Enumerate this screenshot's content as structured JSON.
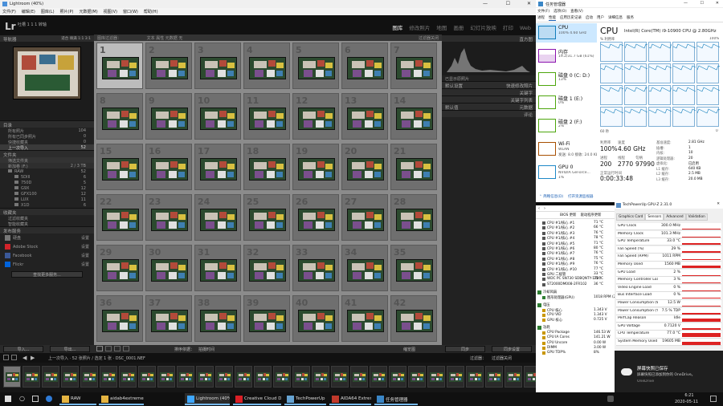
{
  "lightroom": {
    "window_title": "Lightroom (40%)",
    "menu": [
      "文件(F)",
      "编辑(E)",
      "图库(L)",
      "照片(P)",
      "元数据(M)",
      "视图(V)",
      "窗口(W)",
      "帮助(H)"
    ],
    "identity": "吐槽 1 1 1 转轴",
    "logo": "Lr",
    "modules": [
      "图库",
      "修改照片",
      "地图",
      "画册",
      "幻灯片放映",
      "打印",
      "Web"
    ],
    "active_module": "图库",
    "navigator_label": "导航器",
    "navigator_zoom": "适合 填满 1:1 3:1",
    "catalog": {
      "header": "目录",
      "items": [
        {
          "label": "所有照片",
          "count": "104"
        },
        {
          "label": "所有已同步照片",
          "count": "0"
        },
        {
          "label": "快捷收藏夹",
          "count": "0"
        },
        {
          "label": "上一次导入",
          "count": "52"
        }
      ]
    },
    "folders": {
      "header": "文件夹",
      "filter": "筛选文件夹",
      "volume": "新加卷 (F:)",
      "volume_info": "2 / 3 TB",
      "items": [
        {
          "label": "RAW",
          "count": "52"
        },
        {
          "label": "5DIII",
          "count": "6"
        },
        {
          "label": "750D",
          "count": "5"
        },
        {
          "label": "G9X",
          "count": "12"
        },
        {
          "label": "GFX100",
          "count": "12"
        },
        {
          "label": "LUX",
          "count": "11"
        },
        {
          "label": "X1D",
          "count": "6"
        }
      ]
    },
    "collections": {
      "header": "收藏夹",
      "items": [
        "过滤收藏夹",
        "智能收藏夹"
      ]
    },
    "publish": {
      "header": "发布服务",
      "items": [
        {
          "label": "硬盘",
          "badge": "设置"
        },
        {
          "label": "Adobe Stock",
          "badge": "设置"
        },
        {
          "label": "Facebook",
          "badge": "设置"
        },
        {
          "label": "Flickr",
          "badge": "设置"
        }
      ],
      "more": "查找更多服务..."
    },
    "grid_filter": "图库过滤器：",
    "filter_tabs": "文本 属性 元数据 无",
    "filter_preset": "过滤器关闭",
    "right_panel": {
      "histogram": "直方图",
      "histogram_info": "已显示原照片",
      "quick_develop": "快速修改照片",
      "preset_value": "默认设置",
      "keywording": "关键字",
      "keyword_list": "关键字列表",
      "metadata": "元数据",
      "metadata_value": "默认值",
      "comments": "评论"
    },
    "buttons": {
      "import": "导入...",
      "export": "导出...",
      "sync": "同步",
      "sync_settings": "同步设置"
    },
    "toolbar": {
      "sort_label": "排序依据：",
      "sort_value": "拍摄时间",
      "thumbnails": "缩览图"
    },
    "filmstrip_info": "上一次导入 · 52 张照片 / 选定 1 张 · DSC_0001.NEF",
    "filmstrip_filter": "过滤器：",
    "filmstrip_filter_value": "过滤器关闭",
    "grid_count": 42
  },
  "task_manager": {
    "title": "任务管理器",
    "menu": [
      "文件(F)",
      "选项(O)",
      "查看(V)"
    ],
    "tabs": [
      "进程",
      "性能",
      "应用历史记录",
      "启动",
      "用户",
      "详细信息",
      "服务"
    ],
    "active_tab": "性能",
    "sidebar": [
      {
        "name": "CPU",
        "sub": "100% 4.60 GHz"
      },
      {
        "name": "内存",
        "sub": "19.2/31.7 GB (61%)"
      },
      {
        "name": "磁盘 0 (C: D:)",
        "sub": "13%"
      },
      {
        "name": "磁盘 1 (E:)",
        "sub": "0%"
      },
      {
        "name": "磁盘 2 (F:)",
        "sub": "2%"
      },
      {
        "name": "Wi-Fi",
        "sub": "WLAN"
      },
      {
        "name": "GPU 0",
        "sub": "NVIDIA GeForce..."
      }
    ],
    "wifi_rate": "发送: 8.0 接收: 24.0 Kb",
    "gpu_sub": "1%",
    "cpu_title": "CPU",
    "cpu_model": "Intel(R) Core(TM) i9-10900 CPU @ 2.80GHz",
    "util_label": "% 利用率",
    "util_max": "100%",
    "time_label": "60 秒",
    "time_min": "0",
    "stats": {
      "utilization_label": "利用率",
      "utilization": "100%",
      "speed_label": "速度",
      "speed": "4.60 GHz",
      "processes_label": "进程",
      "processes": "200",
      "threads_label": "线程",
      "threads": "2770",
      "handles_label": "句柄",
      "handles": "97990",
      "uptime_label": "正常运行时间",
      "uptime": "0:00:33:48"
    },
    "specs": [
      {
        "k": "基准速度:",
        "v": "2.81 GHz"
      },
      {
        "k": "插槽:",
        "v": "1"
      },
      {
        "k": "内核:",
        "v": "10"
      },
      {
        "k": "逻辑处理器:",
        "v": "20"
      },
      {
        "k": "虚拟化:",
        "v": "已启用"
      },
      {
        "k": "L1 缓存:",
        "v": "640 KB"
      },
      {
        "k": "L2 缓存:",
        "v": "2.5 MB"
      },
      {
        "k": "L3 缓存:",
        "v": "20.0 MB"
      }
    ],
    "summary_link": "简略信息(D)",
    "monitor_link": "打开资源监视器"
  },
  "gpuz": {
    "title": "TechPowerUp GPU-Z 2.31.0",
    "tabs": [
      "Graphics Card",
      "Sensors",
      "Advanced",
      "Validation"
    ],
    "rows": [
      {
        "k": "GPU Clock",
        "v": "300.0 MHz",
        "level": 0.05
      },
      {
        "k": "Memory Clock",
        "v": "101.3 MHz",
        "level": 0.05
      },
      {
        "k": "GPU Temperature",
        "v": "33.0 °C",
        "level": 0.3
      },
      {
        "k": "Fan Speed (%)",
        "v": "29 %",
        "level": 0.25
      },
      {
        "k": "Fan Speed (RPM)",
        "v": "1011 RPM",
        "level": 0.25
      },
      {
        "k": "Memory Used",
        "v": "1560 MB",
        "level": 0.4
      },
      {
        "k": "GPU Load",
        "v": "2 %",
        "level": 0.05
      },
      {
        "k": "Memory Controller Load",
        "v": "3 %",
        "level": 0.05
      },
      {
        "k": "Video Engine Load",
        "v": "0 %",
        "level": 0
      },
      {
        "k": "Bus Interface Load",
        "v": "0 %",
        "level": 0
      },
      {
        "k": "Power Consumption (W)",
        "v": "12.5 W",
        "level": 0.2
      },
      {
        "k": "Power Consumption (%)",
        "v": "7.5 % TDP",
        "level": 0.2
      },
      {
        "k": "PerfCap Reason",
        "v": "Idle",
        "level": 0.6
      },
      {
        "k": "GPU Voltage",
        "v": "0.7120 V",
        "level": 0.3
      },
      {
        "k": "CPU Temperature",
        "v": "77.0 °C",
        "level": 0.8
      },
      {
        "k": "System Memory Used",
        "v": "19605 MB",
        "level": 0.6
      }
    ]
  },
  "aida": {
    "title": "AIDA64 Extreme",
    "toolbar": [
      "BIOS 更新",
      "驱动程序更新"
    ],
    "cores": [
      {
        "k": "CPU #1/核心 #1",
        "v": "71 °C"
      },
      {
        "k": "CPU #1/核心 #2",
        "v": "66 °C"
      },
      {
        "k": "CPU #1/核心 #3",
        "v": "76 °C"
      },
      {
        "k": "CPU #1/核心 #4",
        "v": "78 °C"
      },
      {
        "k": "CPU #1/核心 #5",
        "v": "71 °C"
      },
      {
        "k": "CPU #1/核心 #6",
        "v": "80 °C"
      },
      {
        "k": "CPU #1/核心 #7",
        "v": "76 °C"
      },
      {
        "k": "CPU #1/核心 #8",
        "v": "75 °C"
      },
      {
        "k": "CPU #1/核心 #9",
        "v": "76 °C"
      },
      {
        "k": "CPU #1/核心 #10",
        "v": "77 °C"
      },
      {
        "k": "GPU 二极管",
        "v": "33 °C"
      },
      {
        "k": "WDC PC SN730 SDBQNTY-1T00",
        "v": "35 °C"
      },
      {
        "k": "ST2000DM008-2FR102",
        "v": "36 °C"
      }
    ],
    "cooling_header": "冷却风扇",
    "cooling": [
      {
        "k": "图形处理器(GPU)",
        "v": "1018 RPM (29%)"
      }
    ],
    "voltage_header": "电压",
    "voltage": [
      {
        "k": "CPU 核心",
        "v": "1.343 V"
      },
      {
        "k": "CPU VID",
        "v": "1.343 V"
      },
      {
        "k": "GPU 核心",
        "v": "0.725 V"
      }
    ],
    "power_header": "功耗",
    "power": [
      {
        "k": "CPU Package",
        "v": "146.53 W"
      },
      {
        "k": "CPU IA Cores",
        "v": "141.21 W"
      },
      {
        "k": "CPU Uncore",
        "v": "0.00 W"
      },
      {
        "k": "DIMM",
        "v": "3.00 W"
      },
      {
        "k": "GPU TDP%",
        "v": "8%"
      }
    ]
  },
  "toast": {
    "title": "屏幕快照已保存",
    "body": "屏幕快照已添加到你的 OneDrive。",
    "app": "OneDrive"
  },
  "taskbar": {
    "items": [
      {
        "label": "RAW",
        "color": "#e3b341"
      },
      {
        "label": "aidab4extreme625",
        "color": "#e3b341"
      },
      {
        "label": "Lightroom (40%)",
        "color": "#3ea7ff"
      },
      {
        "label": "Creative Cloud D...",
        "color": "#da1f26"
      },
      {
        "label": "TechPowerUp GP...",
        "color": "#66a3d2"
      },
      {
        "label": "AIDA64 Extreme",
        "color": "#c0392b"
      },
      {
        "label": "任务管理器",
        "color": "#3a86c6"
      }
    ],
    "time": "6:21",
    "date": "2020-05-11"
  }
}
